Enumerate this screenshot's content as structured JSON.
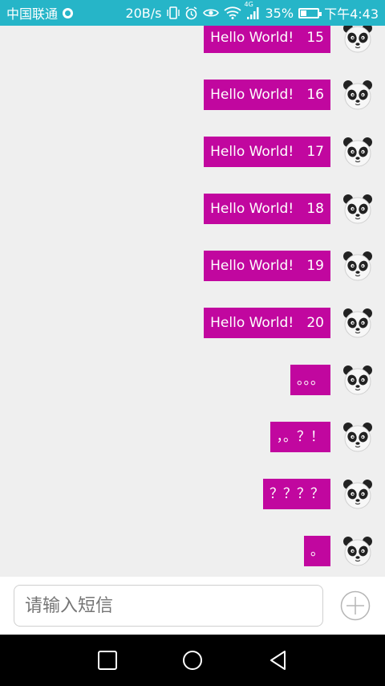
{
  "status_bar": {
    "carrier": "中国联通",
    "speed": "20B/s",
    "network": "4G",
    "battery_percent": "35%",
    "battery_level": 0.35,
    "time": "下午4:43",
    "background": "#26b5c8"
  },
  "messages": [
    {
      "text": "Hello World!   15"
    },
    {
      "text": "Hello World!   16"
    },
    {
      "text": "Hello World!   17"
    },
    {
      "text": "Hello World!   18"
    },
    {
      "text": "Hello World!   19"
    },
    {
      "text": "Hello World!   20"
    },
    {
      "text": "。。。"
    },
    {
      "text": "，。？！"
    },
    {
      "text": "？？？？"
    },
    {
      "text": "。"
    }
  ],
  "bubble_color": "#c1079f",
  "avatar_icon": "panda-icon",
  "input": {
    "placeholder": "请输入短信",
    "value": ""
  },
  "add_icon": "plus-circle-icon",
  "nav": {
    "square_icon": "recent-apps-icon",
    "circle_icon": "home-icon",
    "triangle_icon": "back-icon"
  }
}
